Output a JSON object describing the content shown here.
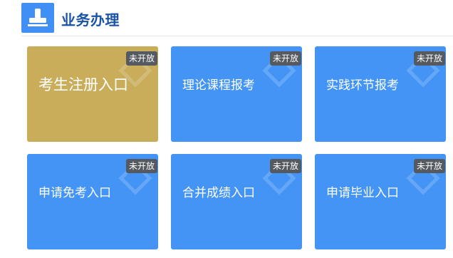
{
  "header": {
    "title": "业务办理",
    "icon": "stamp-icon"
  },
  "colors": {
    "accent": "#3f8ff5",
    "title": "#1a52a8",
    "card_blue": "#4394f5",
    "card_gold": "#c9ad5b",
    "badge": "#555a60"
  },
  "cards": [
    {
      "label": "考生注册入口",
      "status": "未开放"
    },
    {
      "label": "理论课程报考",
      "status": "未开放"
    },
    {
      "label": "实践环节报考",
      "status": "未开放"
    },
    {
      "label": "申请免考入口",
      "status": "未开放"
    },
    {
      "label": "合并成绩入口",
      "status": "未开放"
    },
    {
      "label": "申请毕业入口",
      "status": "未开放"
    }
  ]
}
